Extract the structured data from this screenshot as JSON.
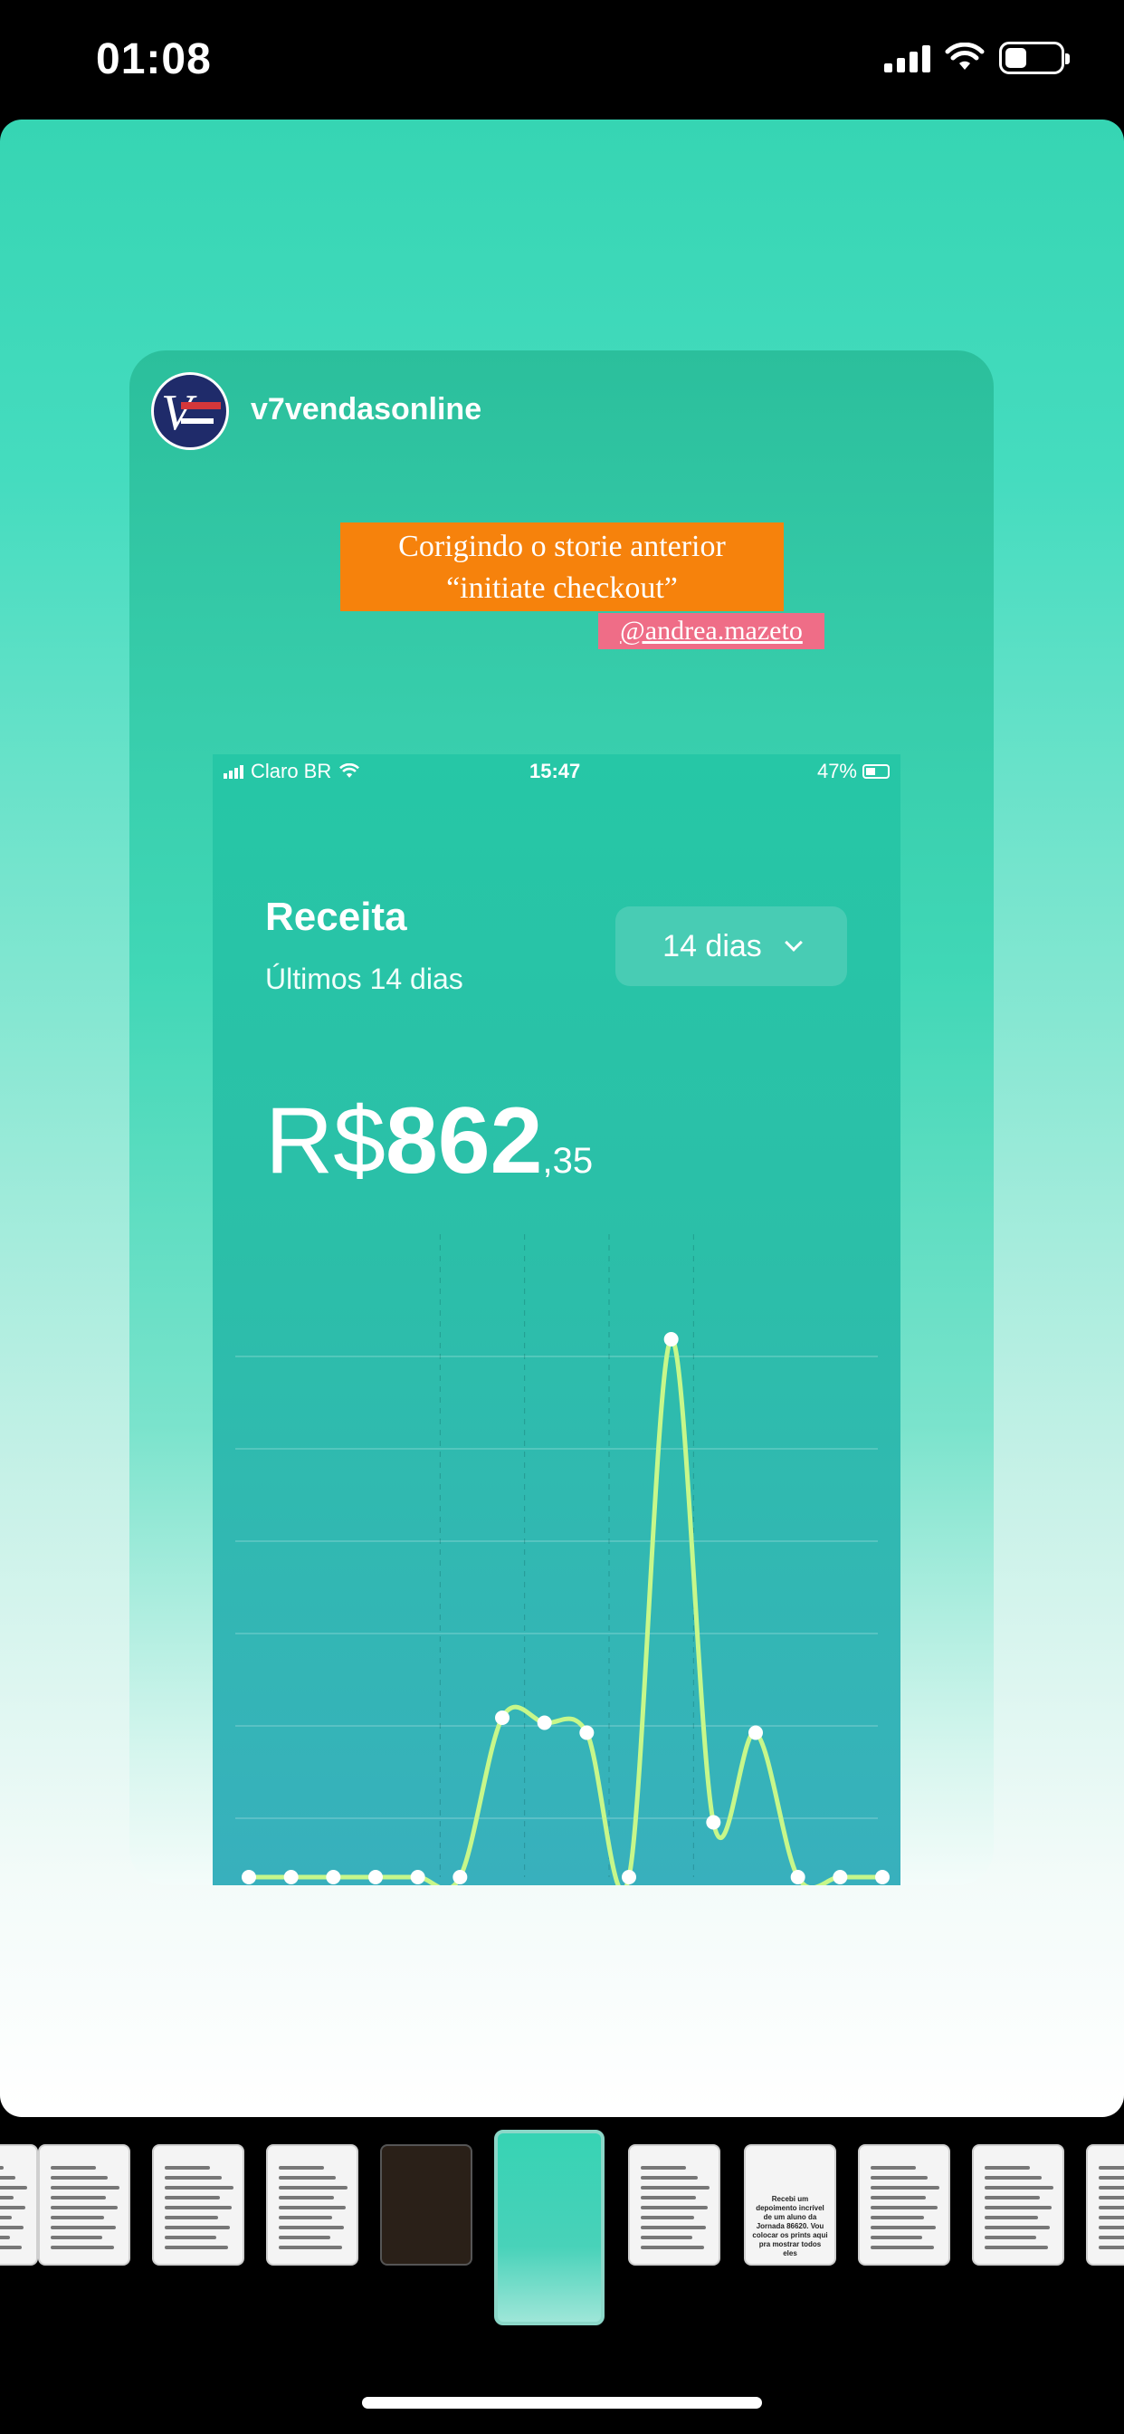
{
  "status_bar": {
    "time": "01:08",
    "signal_bars": 4,
    "battery_level": 0.4
  },
  "story": {
    "username": "v7vendasonline",
    "caption_line1": "Corigindo o storie anterior",
    "caption_line2": "“initiate checkout”",
    "mention": "@andrea.mazeto"
  },
  "inner_screenshot": {
    "status": {
      "carrier": "Claro BR",
      "time": "15:47",
      "battery": "47%"
    },
    "header": {
      "title": "Receita",
      "subtitle": "Últimos 14 dias"
    },
    "range_select": {
      "value": "14 dias"
    },
    "total": {
      "currency": "R$",
      "integer": "862",
      "decimal": ",35"
    },
    "chart_data": {
      "type": "line",
      "x": [
        1,
        2,
        3,
        4,
        5,
        6,
        7,
        8,
        9,
        10,
        11,
        12,
        13,
        14,
        15,
        16
      ],
      "values": [
        0,
        0,
        0,
        0,
        0,
        0,
        160,
        155,
        145,
        0,
        540,
        55,
        145,
        0,
        0,
        0
      ],
      "grid": true,
      "line_color": "#c7f78a"
    },
    "tabbar": [
      "home-icon",
      "analytics-icon",
      "profile-icon"
    ]
  },
  "thumbnails": {
    "count": 11,
    "active_index": 5,
    "text_thumb": "Recebi um depoimento incrível de um aluno da Jornada 86620. Vou colocar os prints aqui pra mostrar todos eles"
  },
  "colors": {
    "story_top": "#36d5b3",
    "caption_bg": "#f6820c",
    "mention_bg": "#ef6d87",
    "chart_line": "#c7f78a"
  }
}
